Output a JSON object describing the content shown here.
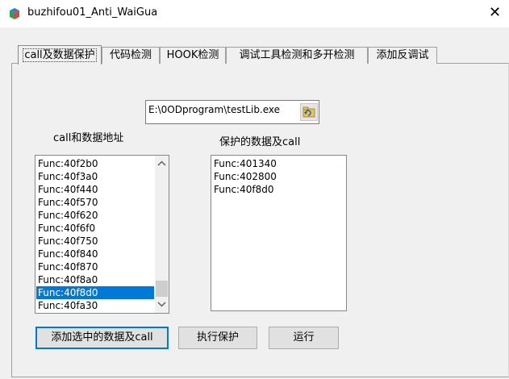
{
  "window": {
    "title": "buzhifou01_Anti_WaiGua",
    "close_glyph": "✕"
  },
  "tabs": [
    "call及数据保护",
    "代码检测",
    "HOOK检测",
    "调试工具检测和多开检测",
    "添加反调试"
  ],
  "file_path": "E:\\0ODprogram\\testLib.exe",
  "left_list": {
    "label": "call和数据地址",
    "items": [
      "Func:40f2b0",
      "Func:40f3a0",
      "Func:40f440",
      "Func:40f570",
      "Func:40f620",
      "Func:40f6f0",
      "Func:40f750",
      "Func:40f840",
      "Func:40f870",
      "Func:40f8a0",
      "Func:40f8d0",
      "Func:40fa30"
    ],
    "selected": "Func:40f8d0"
  },
  "right_list": {
    "label": "保护的数据及call",
    "items": [
      "Func:401340",
      "Func:402800",
      "Func:40f8d0"
    ]
  },
  "buttons": {
    "add": "添加选中的数据及call",
    "protect": "执行保护",
    "run": "运行"
  },
  "colors": {
    "selection": "#0078d7",
    "default_button_border": "#0078d7"
  }
}
